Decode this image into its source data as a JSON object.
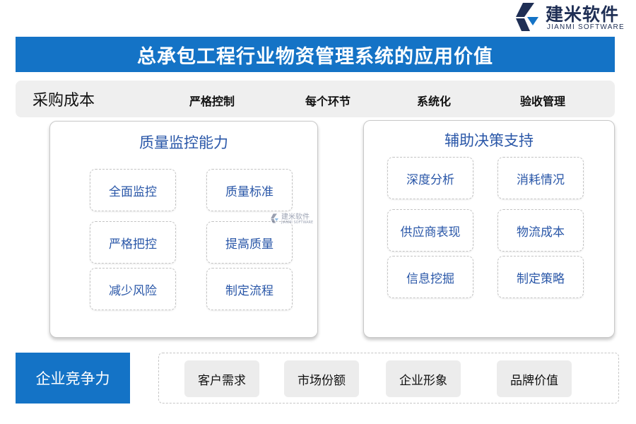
{
  "logo": {
    "name_cn": "建米软件",
    "name_en": "JIANMI SOFTWARE"
  },
  "title": "总承包工程行业物资管理系统的应用价值",
  "procurement": {
    "title": "采购成本",
    "items": [
      "严格控制",
      "每个环节",
      "系统化",
      "验收管理"
    ]
  },
  "quality": {
    "title": "质量监控能力",
    "items": [
      "全面监控",
      "质量标准",
      "严格把控",
      "提高质量",
      "减少风险",
      "制定流程"
    ]
  },
  "decision": {
    "title": "辅助决策支持",
    "items": [
      "深度分析",
      "消耗情况",
      "供应商表现",
      "物流成本",
      "信息挖掘",
      "制定策略"
    ]
  },
  "watermark": {
    "name_cn": "建米软件",
    "name_en": "JIANMI SOFTWARE"
  },
  "competitiveness": {
    "title": "企业竞争力",
    "items": [
      "客户需求",
      "市场份额",
      "企业形象",
      "品牌价值"
    ]
  },
  "colors": {
    "primary_blue": "#1473c6",
    "text_blue": "#2a57a8",
    "logo_dark": "#1f2f55"
  }
}
